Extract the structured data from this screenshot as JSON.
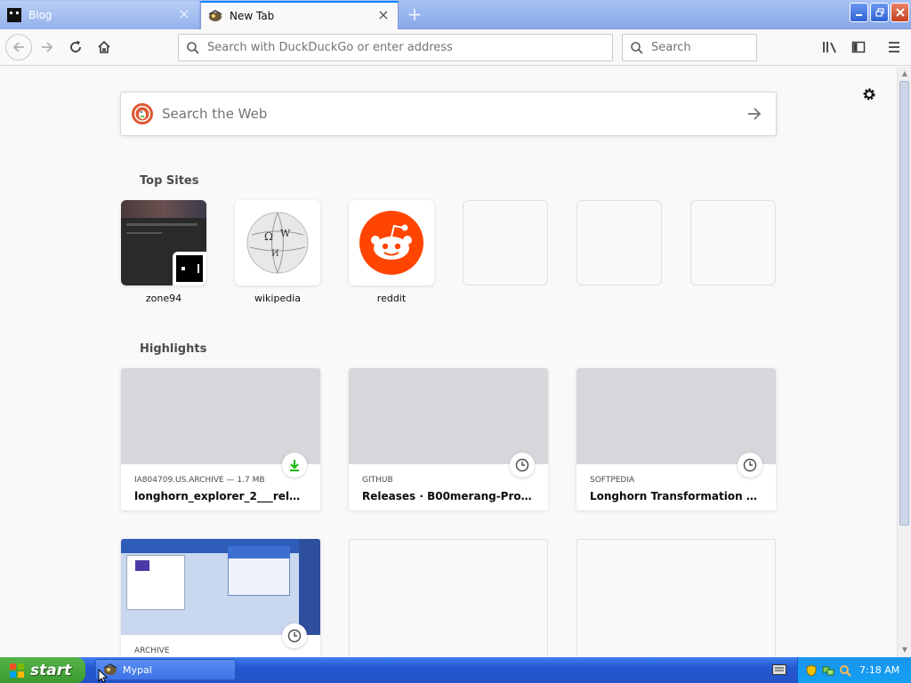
{
  "window": {
    "tabs": [
      {
        "title": "Blog",
        "favicon": "blog-favicon",
        "active": false
      },
      {
        "title": "New Tab",
        "favicon": "mypal-favicon",
        "active": true
      }
    ],
    "new_tab_icon": "plus-icon",
    "controls": {
      "minimize": "minimize-icon",
      "maximize": "maximize-icon",
      "close": "close-icon"
    }
  },
  "navbar": {
    "url_placeholder": "Search with DuckDuckGo or enter address",
    "search_placeholder": "Search"
  },
  "newtab": {
    "web_search_placeholder": "Search the Web",
    "top_sites_title": "Top Sites",
    "top_sites": [
      {
        "label": "zone94"
      },
      {
        "label": "wikipedia"
      },
      {
        "label": "reddit"
      },
      {
        "label": ""
      },
      {
        "label": ""
      },
      {
        "label": ""
      }
    ],
    "highlights_title": "Highlights",
    "highlights": [
      {
        "context": "IA804709.US.ARCHIVE — 1.7 MB",
        "title": "longhorn_explorer_2___released...",
        "badge": "download-icon"
      },
      {
        "context": "GITHUB",
        "title": "Releases · B00merang-Project/...",
        "badge": "clock-icon"
      },
      {
        "context": "SOFTPEDIA",
        "title": "Longhorn Transformation Pack -...",
        "badge": "clock-icon"
      },
      {
        "context": "ARCHIVE",
        "title": "",
        "badge": "clock-icon"
      }
    ],
    "accent": "#0a84ff"
  },
  "taskbar": {
    "start_label": "start",
    "task_label": "Mypal",
    "clock": "7:18 AM"
  }
}
